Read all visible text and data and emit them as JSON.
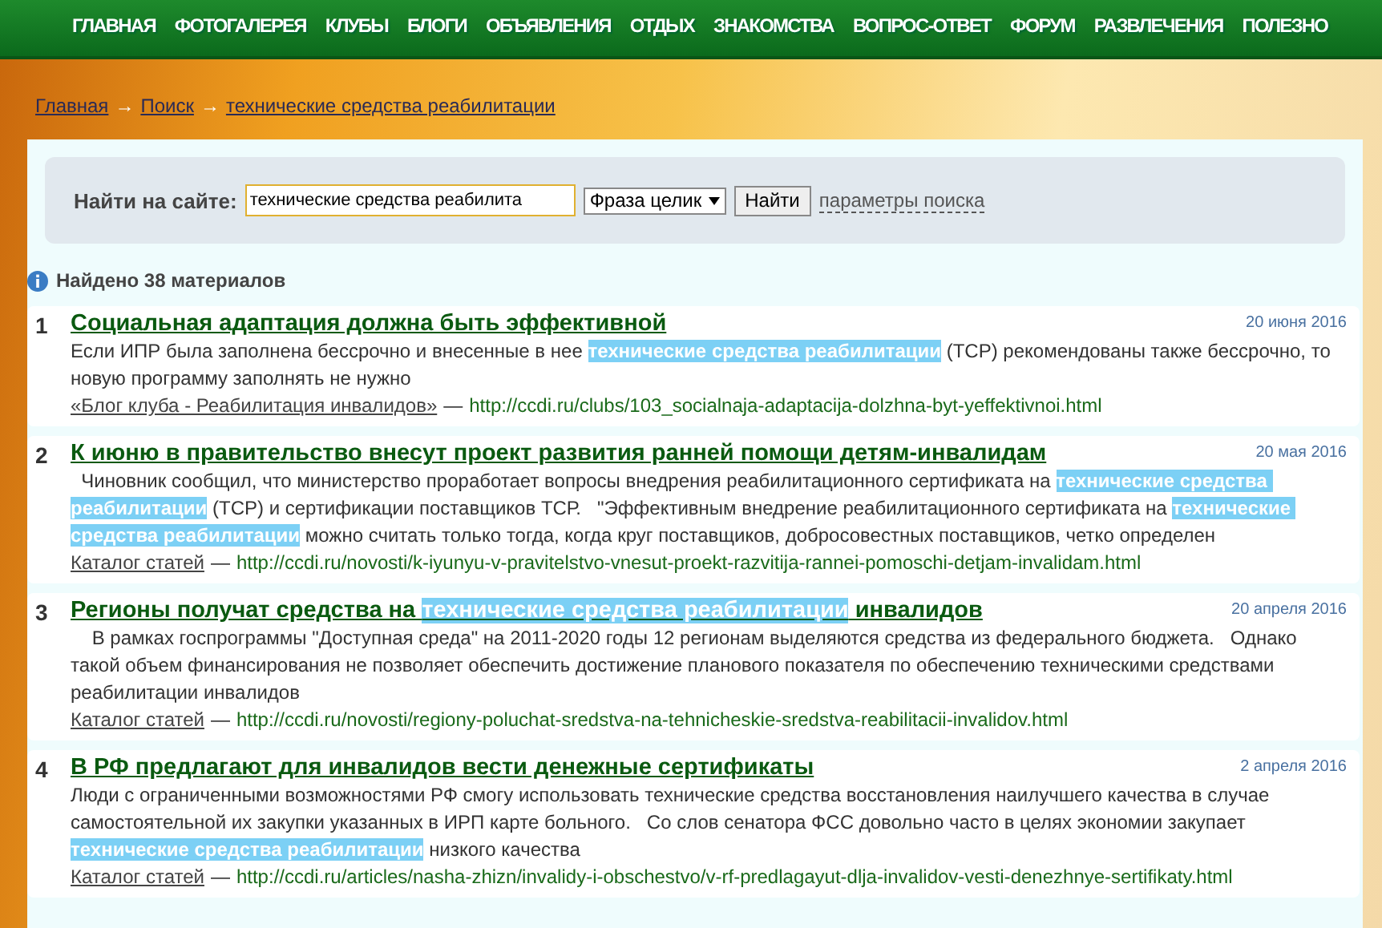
{
  "nav": [
    "ГЛАВНАЯ",
    "ФОТОГАЛЕРЕЯ",
    "КЛУБЫ",
    "БЛОГИ",
    "ОБЪЯВЛЕНИЯ",
    "ОТДЫХ",
    "ЗНАКОМСТВА",
    "ВОПРОС-ОТВЕТ",
    "ФОРУМ",
    "РАЗВЛЕЧЕНИЯ",
    "ПОЛЕЗНО"
  ],
  "breadcrumbs": [
    "Главная",
    "Поиск",
    "технические средства реабилитации"
  ],
  "breadcrumb_separator": "→",
  "search": {
    "label": "Найти на сайте:",
    "value": "технические средства реабилита",
    "mode": "Фраза целик",
    "button": "Найти",
    "params_link": "параметры поиска"
  },
  "found": "Найдено 38 материалов",
  "results": [
    {
      "number": "1",
      "title": [
        {
          "text": "Социальная адаптация должна быть эффективной",
          "highlight": false
        }
      ],
      "date": "20 июня 2016",
      "snippet": [
        {
          "text": "Если ИПР была заполнена бессрочно и внесенные в нее ",
          "highlight": false
        },
        {
          "text": "технические средства реабилитации",
          "highlight": true
        },
        {
          "text": " (ТСР) рекомендованы также бессрочно, то новую программу заполнять не нужно",
          "highlight": false
        }
      ],
      "category": "«Блог клуба - Реабилитация инвалидов»",
      "dash": "—",
      "url": "http://ccdi.ru/clubs/103_socialnaja-adaptacija-dolzhna-byt-yeffektivnoi.html"
    },
    {
      "number": "2",
      "title": [
        {
          "text": "К июню в правительство внесут проект развития ранней помощи детям-инвалидам",
          "highlight": false
        }
      ],
      "date": "20 мая 2016",
      "snippet": [
        {
          "text": "  Чиновник сообщил, что министерство проработает вопросы внедрения реабилитационного сертификата на ",
          "highlight": false
        },
        {
          "text": "технические средства реабилитации",
          "highlight": true
        },
        {
          "text": " (ТСР) и сертификации поставщиков ТСР.   \"Эффективным внедрение реабилитационного сертификата на ",
          "highlight": false
        },
        {
          "text": "технические средства реабилитации",
          "highlight": true
        },
        {
          "text": " можно считать только тогда, когда круг поставщиков, добросовестных поставщиков, четко определен",
          "highlight": false
        }
      ],
      "category": "Каталог статей",
      "dash": "—",
      "url": "http://ccdi.ru/novosti/k-iyunyu-v-pravitelstvo-vnesut-proekt-razvitija-rannei-pomoschi-detjam-invalidam.html"
    },
    {
      "number": "3",
      "title": [
        {
          "text": "Регионы получат средства на ",
          "highlight": false
        },
        {
          "text": "технические средства реабилитации",
          "highlight": true
        },
        {
          "text": " инвалидов",
          "highlight": false
        }
      ],
      "date": "20 апреля 2016",
      "snippet": [
        {
          "text": "    В рамках госпрограммы \"Доступная среда\" на 2011-2020 годы 12 регионам выделяются средства из федерального бюджета.   Однако такой объем финансирования не позволяет обеспечить достижение планового показателя по обеспечению техническими средствами реабилитации инвалидов",
          "highlight": false
        }
      ],
      "category": "Каталог статей",
      "dash": "—",
      "url": "http://ccdi.ru/novosti/regiony-poluchat-sredstva-na-tehnicheskie-sredstva-reabilitacii-invalidov.html"
    },
    {
      "number": "4",
      "title": [
        {
          "text": "В РФ предлагают для инвалидов вести денежные сертификаты",
          "highlight": false
        }
      ],
      "date": "2 апреля 2016",
      "snippet": [
        {
          "text": "Люди с ограниченными возможностями РФ смогу использовать технические средства восстановления наилучшего качества в случае самостоятельной их закупки указанных в ИРП карте больного.   Со слов сенатора ФСС довольно часто в целях экономии закупает ",
          "highlight": false
        },
        {
          "text": "технические средства реабилитации",
          "highlight": true
        },
        {
          "text": " низкого качества",
          "highlight": false
        }
      ],
      "category": "Каталог статей",
      "dash": "—",
      "url": "http://ccdi.ru/articles/nasha-zhizn/invalidy-i-obschestvo/v-rf-predlagayut-dlja-invalidov-vesti-denezhnye-sertifikaty.html"
    }
  ]
}
